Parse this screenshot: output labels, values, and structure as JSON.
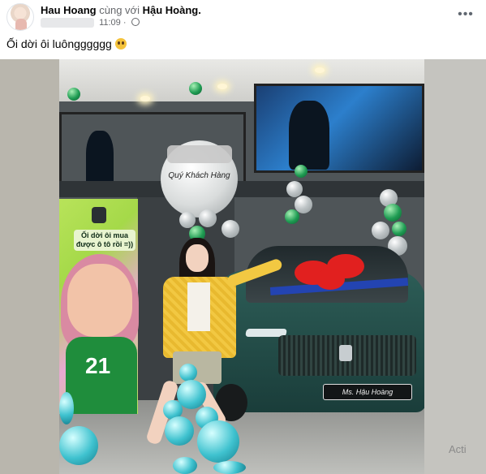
{
  "post": {
    "author_name": "Hau Hoang",
    "with_text": "cùng với",
    "tagged_name": "Hậu Hoàng.",
    "time": "11:09",
    "dot": "·",
    "more_label": "•••",
    "caption": "Ối dời ôi luôngggggg"
  },
  "photo": {
    "banner_text": "Ối dời ôi mua được ô tô rồi =))",
    "jersey_number": "21",
    "balloon_text": "Quý Khách Hàng",
    "plate_text": "Ms. Hậu Hoàng"
  },
  "overlay": {
    "watermark": "Acti"
  },
  "icons": [
    "avatar",
    "globe-icon",
    "more-icon",
    "emoji-icon"
  ],
  "colors": {
    "name_text": "#050505",
    "secondary_text": "#65676b",
    "background": "#ffffff"
  }
}
